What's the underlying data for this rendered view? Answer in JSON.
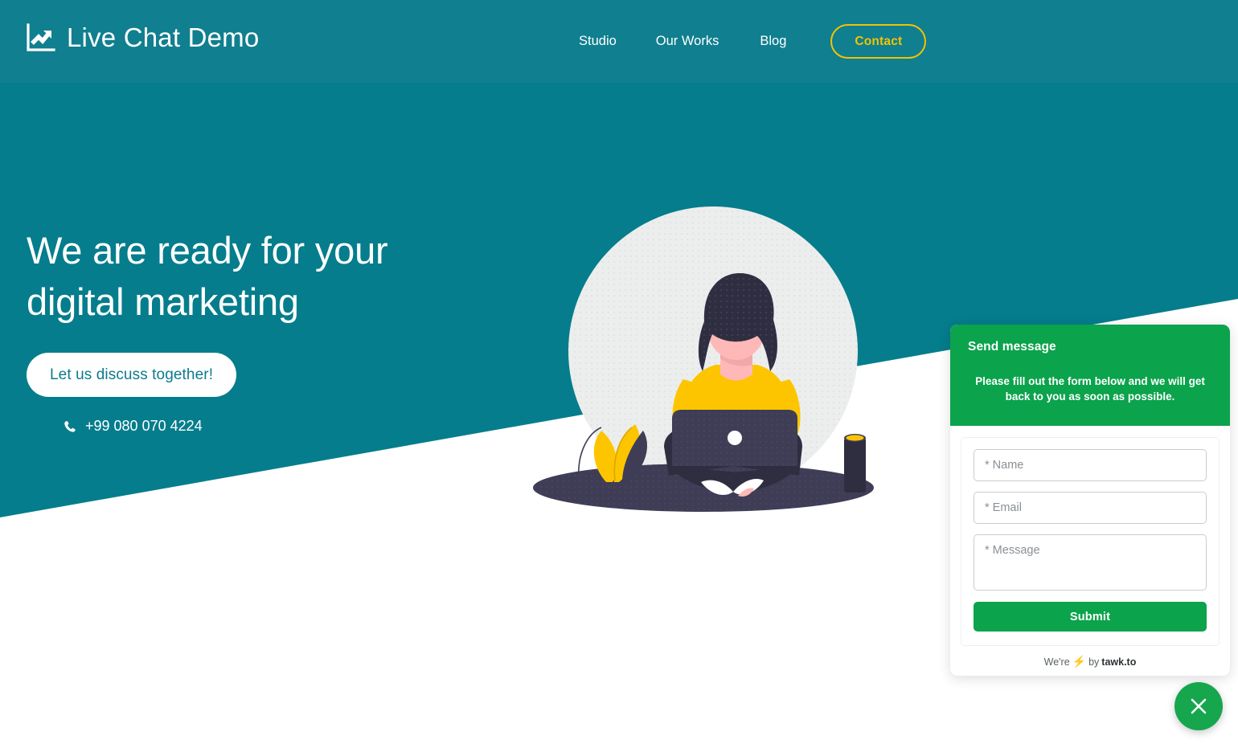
{
  "site": {
    "brand_name": "Live Chat Demo",
    "brand_icon": "line-chart-growth-icon",
    "teal": "#057d8c",
    "navbar_teal": "#107f8f",
    "accent_yellow": "#f3c300",
    "widget_green": "#0ba34c"
  },
  "nav": {
    "links": [
      {
        "label": "Studio"
      },
      {
        "label": "Our Works"
      },
      {
        "label": "Blog"
      }
    ],
    "cta": {
      "label": "Contact"
    }
  },
  "hero": {
    "title_line1": "We are ready for your",
    "title_line2": "digital marketing",
    "cta_label": "Let us discuss together!",
    "phone_icon": "phone-icon",
    "phone": "+99 080 070 4224"
  },
  "illustration": {
    "name": "woman-sitting-with-laptop-illustration",
    "circle_color": "#eceeed",
    "skin_color": "#ffb8b8",
    "hair_color": "#2f2e41",
    "shirt_color": "#fdc500",
    "ground_color": "#3f3d56"
  },
  "chat_widget": {
    "header_title": "Send message",
    "header_subtitle": "Please fill out the form below and we will get back to you as soon as possible.",
    "fields": {
      "name_placeholder": "* Name",
      "name_value": "",
      "email_placeholder": "* Email",
      "email_value": "",
      "message_placeholder": "* Message",
      "message_value": ""
    },
    "submit_label": "Submit",
    "footer": {
      "prefix": "We're",
      "bolt_icon": "lightning-bolt-icon",
      "middle": "by",
      "brand": "tawk.to"
    }
  },
  "fab": {
    "icon": "close-icon",
    "label": "Close chat"
  }
}
